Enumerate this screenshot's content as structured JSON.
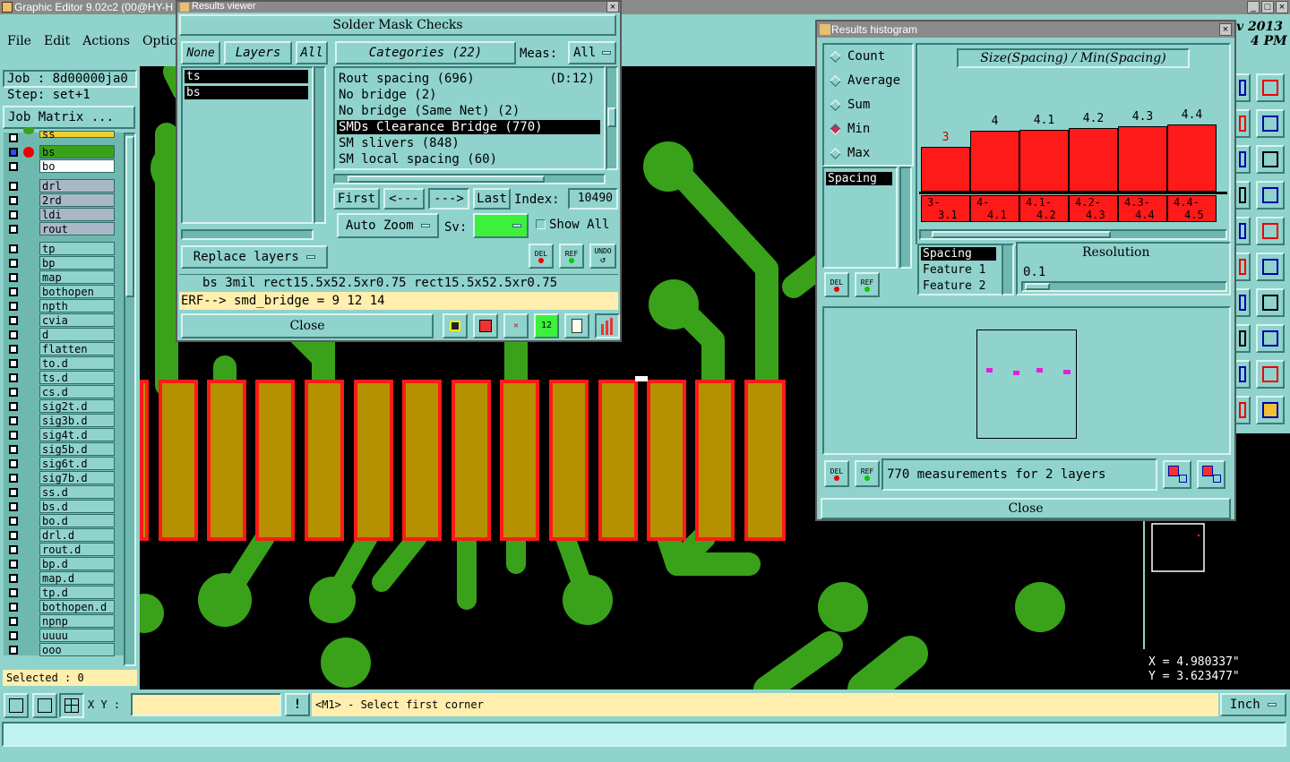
{
  "main_window": {
    "title": "Graphic Editor 9.02c2 (00@HY-H",
    "clock_top": "v 2013",
    "clock_bottom": "4 PM"
  },
  "menu": [
    "File",
    "Edit",
    "Actions",
    "Optic"
  ],
  "job": {
    "job_label": "Job : 8d00000ja0",
    "step_label": "Step: set+1",
    "matrix_button": "Job Matrix ..."
  },
  "layers": [
    "ss",
    "bs",
    "bo",
    "drl",
    "2rd",
    "ldi",
    "rout",
    "tp",
    "bp",
    "map",
    "bothopen",
    "npth",
    "cvia",
    "d",
    "flatten",
    "to.d",
    "ts.d",
    "cs.d",
    "sig2t.d",
    "sig3b.d",
    "sig4t.d",
    "sig5b.d",
    "sig6t.d",
    "sig7b.d",
    "ss.d",
    "bs.d",
    "bo.d",
    "drl.d",
    "rout.d",
    "bp.d",
    "map.d",
    "tp.d",
    "bothopen.d",
    "npnp",
    "uuuu",
    "ooo"
  ],
  "selected_count": "Selected : 0",
  "results_viewer": {
    "title": "Results viewer",
    "header": "Solder Mask Checks",
    "none_btn": "None",
    "layers_btn": "Layers",
    "all_btn": "All",
    "layer_list": [
      "ts",
      "bs"
    ],
    "categories_btn": "Categories (22)",
    "meas_label": "Meas:",
    "meas_value": "All",
    "categories": [
      {
        "text": "Rout spacing (696)",
        "extra": "(D:12)"
      },
      {
        "text": "No bridge (2)",
        "extra": ""
      },
      {
        "text": "No bridge (Same Net) (2)",
        "extra": ""
      },
      {
        "text": "SMDs Clearance Bridge (770)",
        "extra": ""
      },
      {
        "text": "SM slivers (848)",
        "extra": ""
      },
      {
        "text": "SM local spacing (60)",
        "extra": ""
      }
    ],
    "first_btn": "First",
    "prev_btn": "<---",
    "next_btn": "--->",
    "last_btn": "Last",
    "index_label": "Index:",
    "index_value": "10490",
    "auto_zoom": "Auto Zoom",
    "sv_label": "Sv:",
    "show_all": "Show All",
    "replace_layers": "Replace layers",
    "del": "DEL",
    "ref": "REF",
    "undo": "UNDO",
    "info_line": "bs 3mil   rect15.5x52.5xr0.75   rect15.5x52.5xr0.75",
    "erf_line": "ERF--> smd_bridge = 9 12 14",
    "close": "Close"
  },
  "histogram": {
    "title": "Results histogram",
    "modes": [
      "Count",
      "Average",
      "Sum",
      "Min",
      "Max"
    ],
    "selected_mode": "Min",
    "chart_title": "Size(Spacing) / Min(Spacing)",
    "left_list": [
      "Spacing"
    ],
    "bars": [
      {
        "value": "3",
        "range_top": "3-",
        "range_bottom": "3.1",
        "height": 0.56
      },
      {
        "value": "4",
        "range_top": "4-",
        "range_bottom": "4.1",
        "height": 0.75
      },
      {
        "value": "4.1",
        "range_top": "4.1-",
        "range_bottom": "4.2",
        "height": 0.77
      },
      {
        "value": "4.2",
        "range_top": "4.2-",
        "range_bottom": "4.3",
        "height": 0.79
      },
      {
        "value": "4.3",
        "range_top": "4.3-",
        "range_bottom": "4.4",
        "height": 0.81
      },
      {
        "value": "4.4",
        "range_top": "4.4-",
        "range_bottom": "4.5",
        "height": 0.83
      }
    ],
    "attr_list": [
      "Spacing",
      "Feature 1",
      "Feature 2"
    ],
    "resolution_label": "Resolution",
    "resolution_value": "0.1",
    "summary": "770 measurements for 2 layers",
    "del": "DEL",
    "ref": "REF",
    "close": "Close"
  },
  "coords": {
    "x": "X = 4.980337\"",
    "y": "Y = 3.623477\""
  },
  "bottom": {
    "xy_label": "X Y :",
    "xy_value": "",
    "bang": "!",
    "status": "<M1> - Select first corner",
    "units": "Inch"
  },
  "colors": {
    "panel": "#8fd3cc",
    "trace": "#3aa21a",
    "pad": "#b59000",
    "pad_outline": "#ff1a1a",
    "bar": "#ff1a1a",
    "status_yellow": "#ffeead"
  }
}
